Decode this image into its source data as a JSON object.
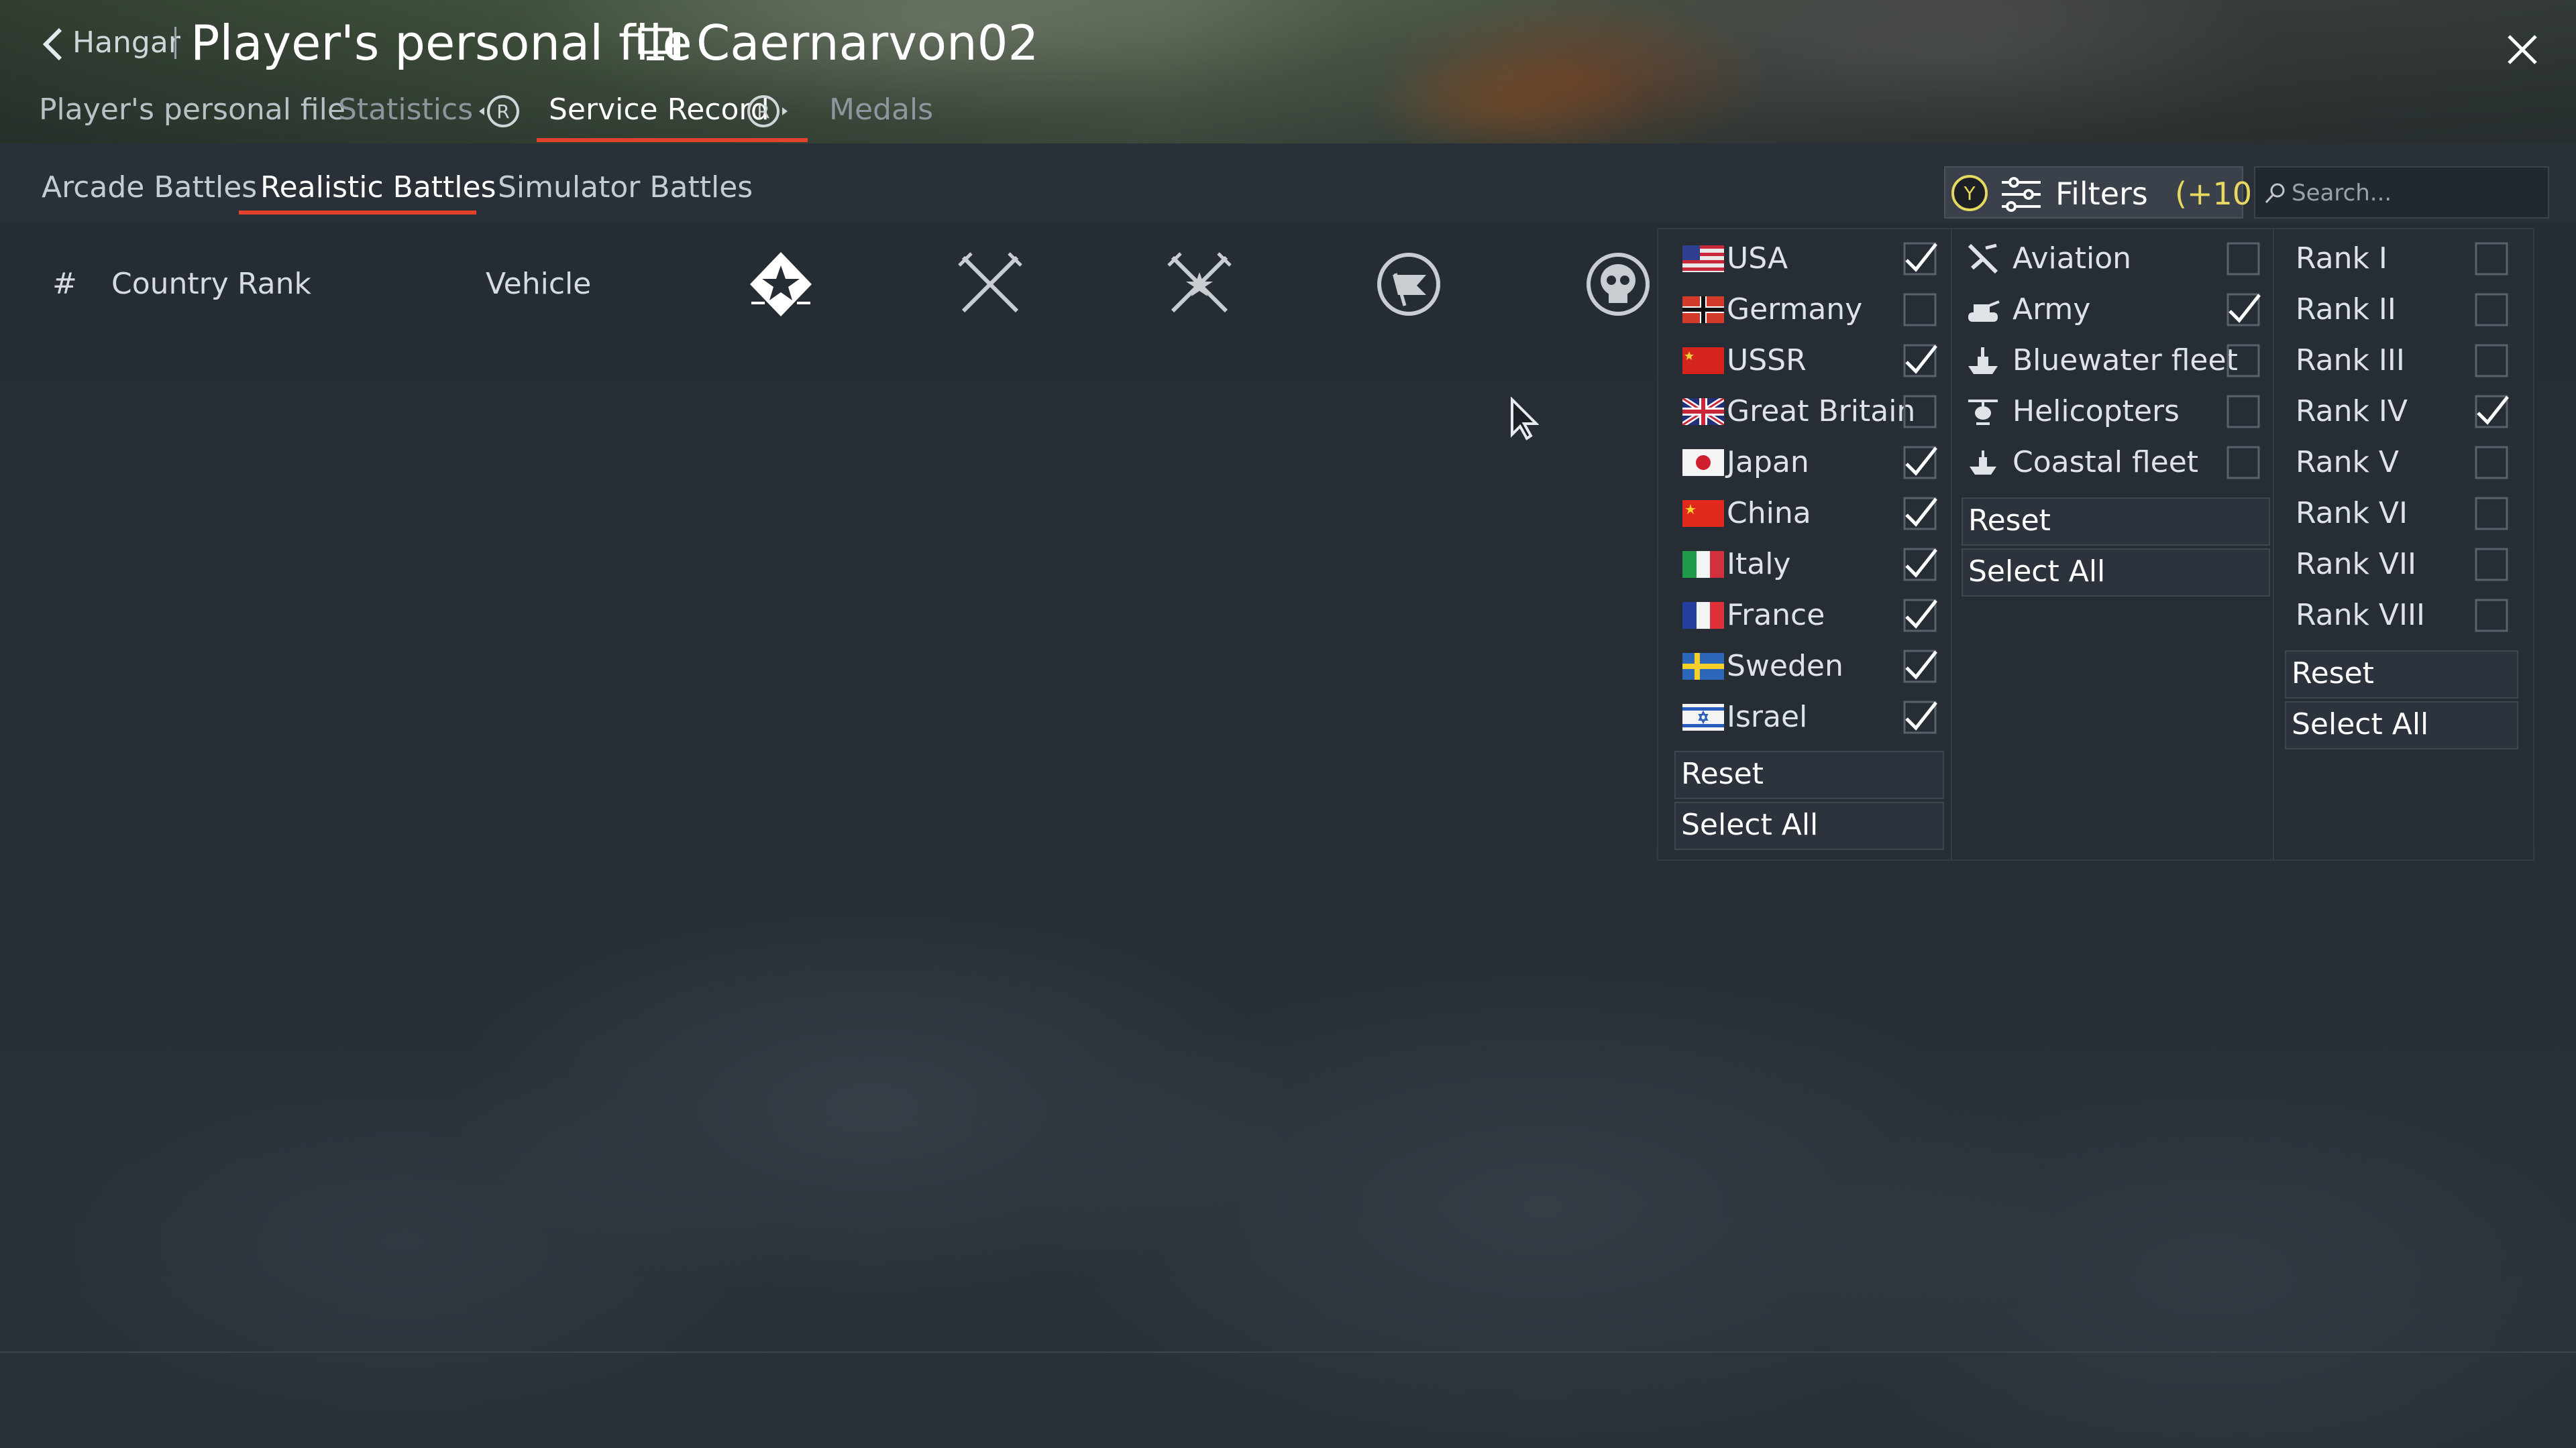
{
  "header": {
    "back_label": "Hangar",
    "title": "Player's personal file",
    "username": "Caernarvon02",
    "subnav": [
      "Player's personal file",
      "Statistics",
      "Service Record",
      "Medals"
    ],
    "subnav_active": "Service Record"
  },
  "tabs": [
    "Arcade Battles",
    "Realistic Battles",
    "Simulator Battles"
  ],
  "active_tab": "Realistic Battles",
  "filters": {
    "label": "Filters",
    "count": "(+10)",
    "button_glyph": "Y"
  },
  "search": {
    "placeholder": "Search..."
  },
  "table_headers": [
    "#",
    "Country",
    "Rank",
    "Vehicle"
  ],
  "column_icons": [
    "star-badge-icon",
    "crossed-swords-icon",
    "crossed-swords-star-icon",
    "flag-capture-icon",
    "skull-icon"
  ],
  "country_filter": {
    "items": [
      {
        "label": "USA",
        "checked": true,
        "flag": "usa-flag-icon"
      },
      {
        "label": "Germany",
        "checked": false,
        "flag": "germany-flag-icon"
      },
      {
        "label": "USSR",
        "checked": true,
        "flag": "ussr-flag-icon"
      },
      {
        "label": "Great Britain",
        "checked": false,
        "flag": "great-britain-flag-icon"
      },
      {
        "label": "Japan",
        "checked": true,
        "flag": "japan-flag-icon"
      },
      {
        "label": "China",
        "checked": true,
        "flag": "china-flag-icon"
      },
      {
        "label": "Italy",
        "checked": true,
        "flag": "italy-flag-icon"
      },
      {
        "label": "France",
        "checked": true,
        "flag": "france-flag-icon"
      },
      {
        "label": "Sweden",
        "checked": true,
        "flag": "sweden-flag-icon"
      },
      {
        "label": "Israel",
        "checked": true,
        "flag": "israel-flag-icon"
      }
    ],
    "reset": "Reset",
    "select_all": "Select All"
  },
  "type_filter": {
    "items": [
      {
        "label": "Aviation",
        "checked": false,
        "icon": "aircraft-icon"
      },
      {
        "label": "Army",
        "checked": true,
        "icon": "tank-icon"
      },
      {
        "label": "Bluewater fleet",
        "checked": false,
        "icon": "ship-icon"
      },
      {
        "label": "Helicopters",
        "checked": false,
        "icon": "helicopter-icon"
      },
      {
        "label": "Coastal fleet",
        "checked": false,
        "icon": "boat-icon"
      }
    ],
    "reset": "Reset",
    "select_all": "Select All"
  },
  "rank_filter": {
    "items": [
      {
        "label": "Rank I",
        "checked": false
      },
      {
        "label": "Rank II",
        "checked": false
      },
      {
        "label": "Rank III",
        "checked": false
      },
      {
        "label": "Rank IV",
        "checked": true
      },
      {
        "label": "Rank V",
        "checked": false
      },
      {
        "label": "Rank VI",
        "checked": false
      },
      {
        "label": "Rank VII",
        "checked": false
      },
      {
        "label": "Rank VIII",
        "checked": false
      }
    ],
    "reset": "Reset",
    "select_all": "Select All"
  },
  "colors": {
    "accent": "#e2412b",
    "filter_count": "#e9d860"
  }
}
